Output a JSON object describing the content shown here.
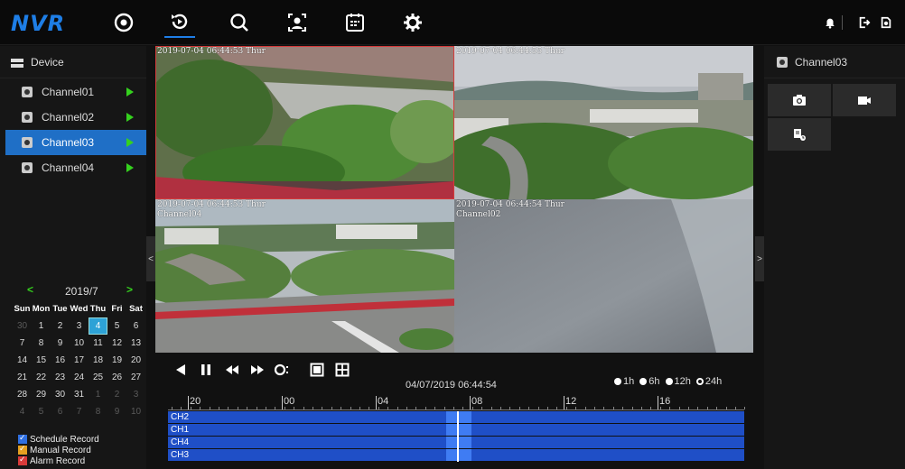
{
  "app": {
    "logo": "NVR"
  },
  "nav": [
    {
      "name": "live-view",
      "icon": "live-view-icon"
    },
    {
      "name": "playback",
      "icon": "playback-icon",
      "active": true
    },
    {
      "name": "search",
      "icon": "search-icon"
    },
    {
      "name": "face",
      "icon": "face-recognition-icon"
    },
    {
      "name": "schedule",
      "icon": "calendar-icon"
    },
    {
      "name": "settings",
      "icon": "gear-icon"
    }
  ],
  "topright": [
    "bell-icon",
    "logout-icon",
    "power-icon"
  ],
  "device": {
    "title": "Device",
    "channels": [
      {
        "label": "Channel01"
      },
      {
        "label": "Channel02"
      },
      {
        "label": "Channel03",
        "selected": true
      },
      {
        "label": "Channel04"
      }
    ]
  },
  "calendar": {
    "prev": "<",
    "next": ">",
    "month": "2019/7",
    "weekdays": [
      "Sun",
      "Mon",
      "Tue",
      "Wed",
      "Thu",
      "Fri",
      "Sat"
    ],
    "days": [
      {
        "d": "30",
        "other": true
      },
      {
        "d": "1"
      },
      {
        "d": "2"
      },
      {
        "d": "3"
      },
      {
        "d": "4",
        "sel": true
      },
      {
        "d": "5"
      },
      {
        "d": "6"
      },
      {
        "d": "7"
      },
      {
        "d": "8"
      },
      {
        "d": "9"
      },
      {
        "d": "10"
      },
      {
        "d": "11"
      },
      {
        "d": "12"
      },
      {
        "d": "13"
      },
      {
        "d": "14"
      },
      {
        "d": "15"
      },
      {
        "d": "16"
      },
      {
        "d": "17"
      },
      {
        "d": "18"
      },
      {
        "d": "19"
      },
      {
        "d": "20"
      },
      {
        "d": "21"
      },
      {
        "d": "22"
      },
      {
        "d": "23"
      },
      {
        "d": "24"
      },
      {
        "d": "25"
      },
      {
        "d": "26"
      },
      {
        "d": "27"
      },
      {
        "d": "28"
      },
      {
        "d": "29"
      },
      {
        "d": "30"
      },
      {
        "d": "31"
      },
      {
        "d": "1",
        "other": true
      },
      {
        "d": "2",
        "other": true
      },
      {
        "d": "3",
        "other": true
      },
      {
        "d": "4",
        "other": true
      },
      {
        "d": "5",
        "other": true
      },
      {
        "d": "6",
        "other": true
      },
      {
        "d": "7",
        "other": true
      },
      {
        "d": "8",
        "other": true
      },
      {
        "d": "9",
        "other": true
      },
      {
        "d": "10",
        "other": true
      }
    ]
  },
  "legend": [
    {
      "label": "Schedule Record",
      "color": "#2f6fe0"
    },
    {
      "label": "Manual Record",
      "color": "#e5a020"
    },
    {
      "label": "Alarm Record",
      "color": "#d93a3a"
    }
  ],
  "collapse": {
    "left": "<",
    "right": ">"
  },
  "video": {
    "cells": [
      {
        "ts": "2019-07-04 06:44:53 Thur",
        "name": "",
        "active": true
      },
      {
        "ts": "2019-07-04 06:44:55 Thur",
        "name": ""
      },
      {
        "ts": "2019-07-04 06:44:53 Thur",
        "name": "Channel04"
      },
      {
        "ts": "2019-07-04 06:44:54 Thur",
        "name": "Channel02"
      }
    ]
  },
  "rightpanel": {
    "title": "Channel03",
    "buttons": [
      "snapshot-icon",
      "record-icon",
      "clip-export-icon"
    ]
  },
  "playback": {
    "current_time": "04/07/2019 06:44:54",
    "spans": [
      {
        "label": "1h",
        "selected": false
      },
      {
        "label": "6h",
        "selected": false
      },
      {
        "label": "12h",
        "selected": false
      },
      {
        "label": "24h",
        "selected": true
      }
    ],
    "ruler": [
      "20",
      "00",
      "04",
      "08",
      "12",
      "16"
    ],
    "tracks": [
      "CH2",
      "CH1",
      "CH4",
      "CH3"
    ]
  }
}
